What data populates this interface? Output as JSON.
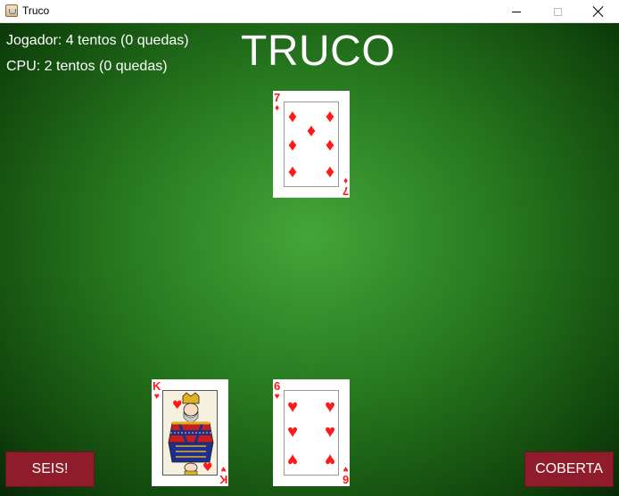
{
  "window": {
    "title": "Truco",
    "icon": "java-cup-icon"
  },
  "table": {
    "title": "TRUCO",
    "player_score": "Jogador: 4 tentos (0 quedas)",
    "cpu_score": "CPU: 2 tentos (0 quedas)",
    "felt_color": "#2c8a22"
  },
  "cards": {
    "cpu_played": {
      "rank": "7",
      "suit_symbol": "♦",
      "suit": "diamonds"
    },
    "player_hand": [
      {
        "rank": "K",
        "suit_symbol": "♥",
        "suit": "hearts"
      },
      {
        "rank": "6",
        "suit_symbol": "♥",
        "suit": "hearts"
      }
    ]
  },
  "buttons": {
    "seis_label": "SEIS!",
    "coberta_label": "COBERTA",
    "color": "#8e1c2a"
  }
}
